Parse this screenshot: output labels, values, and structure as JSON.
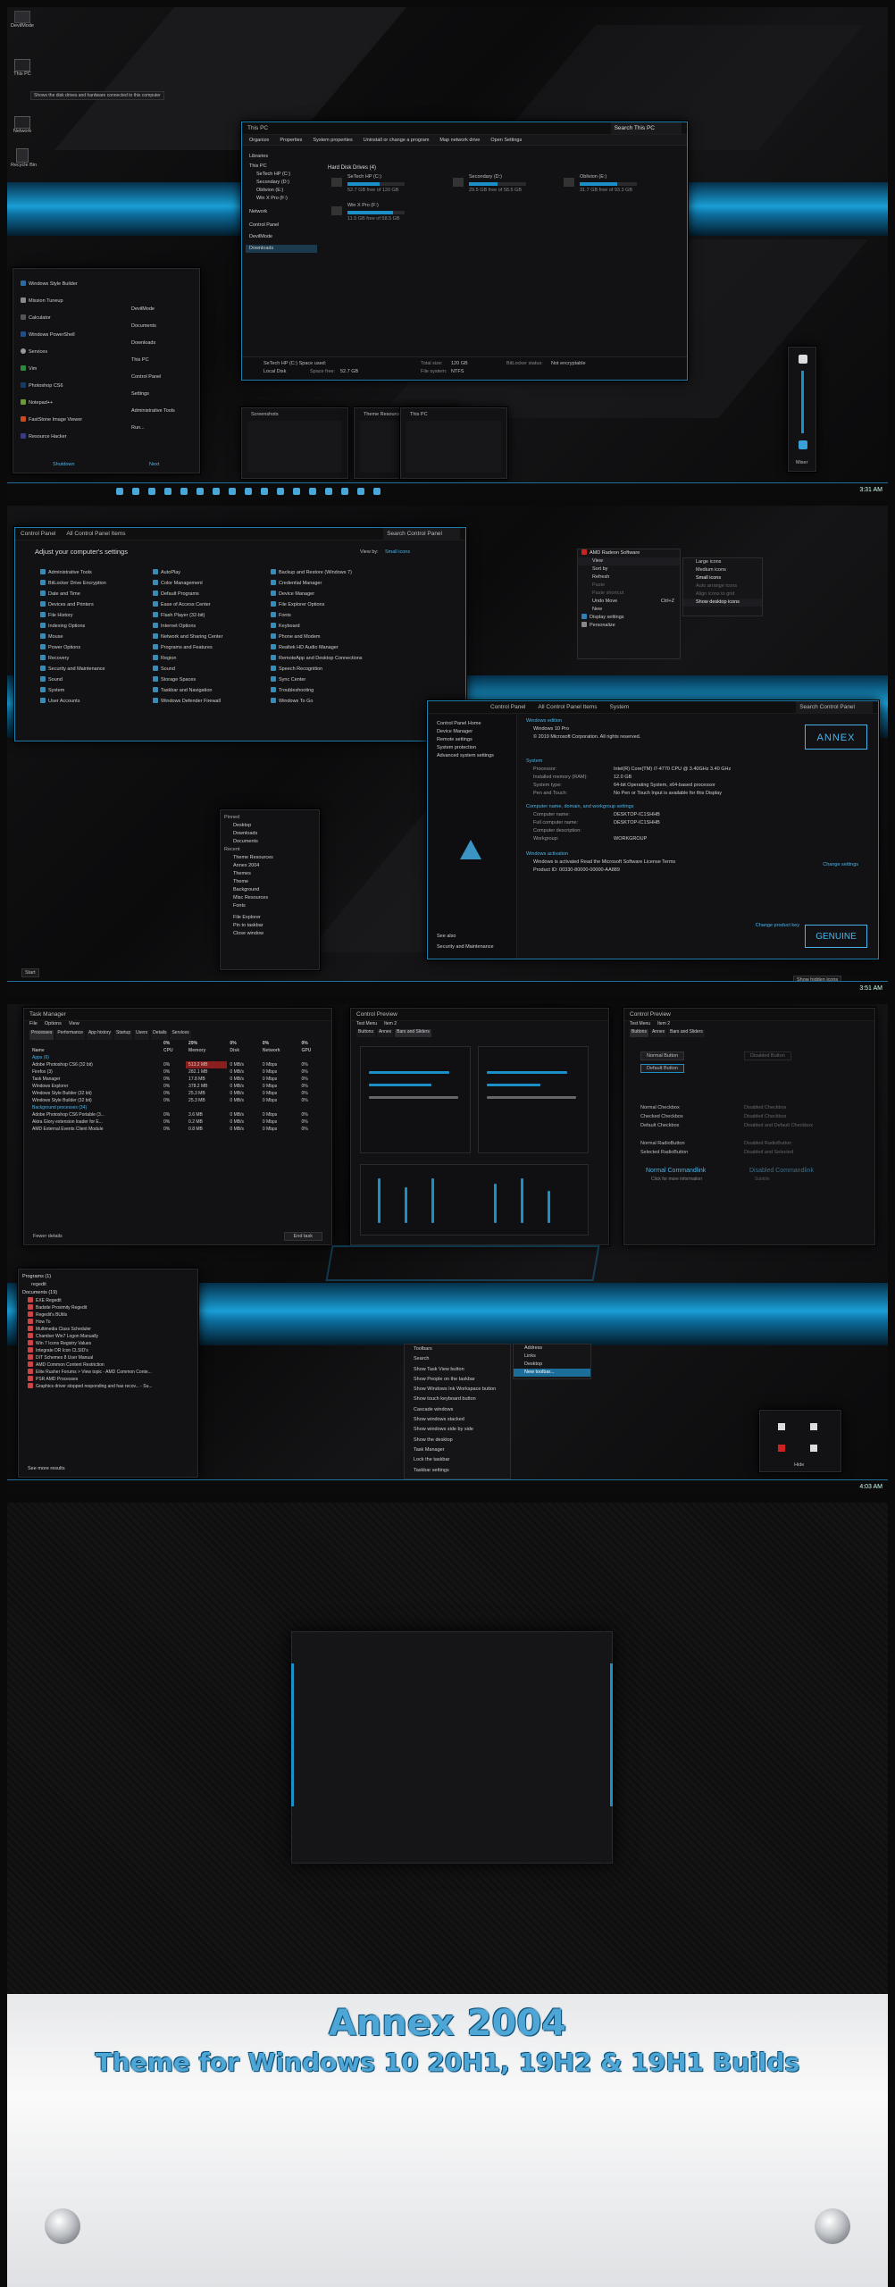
{
  "panel1": {
    "desktop_icons": [
      "DevilMode",
      "This PC",
      "Network",
      "Recycle Bin"
    ],
    "tooltip": "Shows the disk drives and hardware connected to this computer",
    "explorer": {
      "title": "This PC",
      "search_placeholder": "Search This PC",
      "ribbon": [
        "Organize",
        "Properties",
        "System properties",
        "Uninstall or change a program",
        "Map network drive",
        "Open Settings"
      ],
      "nav": [
        "Libraries",
        "This PC",
        "SeTech HP (C:)",
        "Secondary (D:)",
        "Oblivion (E:)",
        "Win X Pro (F:)",
        "Network",
        "Control Panel",
        "DevilMode",
        "Downloads"
      ],
      "group_header": "Hard Disk Drives (4)",
      "drives": [
        {
          "name": "SeTech HP (C:)",
          "free": "52.7 GB free of 120 GB",
          "fill": 0.56
        },
        {
          "name": "Secondary (D:)",
          "free": "29.5 GB free of 58.5 GB",
          "fill": 0.5
        },
        {
          "name": "Oblivion (E:)",
          "free": "31.7 GB free of 93.3 GB",
          "fill": 0.66
        },
        {
          "name": "Win X Pro (F:)",
          "free": "11.5 GB free of 58.5 GB",
          "fill": 0.8
        }
      ],
      "details": {
        "drive": "SeTech HP (C:) Space used:",
        "type": "Local Disk",
        "space_free_label": "Space free:",
        "space_free": "52.7 GB",
        "total_label": "Total size:",
        "total": "120 GB",
        "fs_label": "File system:",
        "fs": "NTFS",
        "bitlocker_label": "BitLocker status:",
        "bitlocker": "Not encryptable"
      }
    },
    "start_menu": {
      "left": [
        "Windows Style Builder",
        "Mission Tuneup",
        "Calculator",
        "Windows PowerShell",
        "Services",
        "Vim",
        "Photoshop CS6",
        "Notepad++",
        "FastStone Image Viewer",
        "Resource Hacker"
      ],
      "right": [
        "DevilMode",
        "Documents",
        "Downloads",
        "This PC",
        "Control Panel",
        "Settings",
        "Administrative Tools",
        "Run..."
      ],
      "footer_left": "Shutdown",
      "footer_right": "Next"
    },
    "thumbnails": [
      "Screenshots",
      "Theme Resources",
      "This PC"
    ],
    "volume_label": "Mixer",
    "clock": "3:31 AM"
  },
  "panel2": {
    "control_panel": {
      "breadcrumb": [
        "Control Panel",
        "All Control Panel Items"
      ],
      "search": "Search Control Panel",
      "header": "Adjust your computer's settings",
      "view_by": "View by:",
      "view_mode": "Small icons",
      "col1": [
        "Administrative Tools",
        "BitLocker Drive Encryption",
        "Date and Time",
        "Devices and Printers",
        "File History",
        "Indexing Options",
        "Mouse",
        "Power Options",
        "Recovery",
        "Security and Maintenance",
        "Sound",
        "System",
        "User Accounts"
      ],
      "col2": [
        "AutoPlay",
        "Color Management",
        "Default Programs",
        "Ease of Access Center",
        "Flash Player (32-bit)",
        "Internet Options",
        "Network and Sharing Center",
        "Programs and Features",
        "Region",
        "Sound",
        "Storage Spaces",
        "Taskbar and Navigation",
        "Windows Defender Firewall"
      ],
      "col3": [
        "Backup and Restore (Windows 7)",
        "Credential Manager",
        "Device Manager",
        "File Explorer Options",
        "Fonts",
        "Keyboard",
        "Phone and Modem",
        "Realtek HD Audio Manager",
        "RemoteApp and Desktop Connections",
        "Speech Recognition",
        "Sync Center",
        "Troubleshooting",
        "Windows To Go"
      ]
    },
    "context_menu": {
      "header": "AMD Radeon Software",
      "items": [
        "View",
        "Sort by",
        "Refresh",
        "Paste",
        "Paste shortcut",
        "Undo Move",
        "New",
        "Display settings",
        "Personalize"
      ],
      "undo_shortcut": "Ctrl+Z",
      "submenu": [
        "Large icons",
        "Medium icons",
        "Small icons",
        "Auto arrange icons",
        "Align icons to grid",
        "Show desktop icons"
      ]
    },
    "system": {
      "breadcrumb": [
        "Control Panel",
        "All Control Panel Items",
        "System"
      ],
      "search": "Search Control Panel",
      "sidebar": [
        "Control Panel Home",
        "Device Manager",
        "Remote settings",
        "System protection",
        "Advanced system settings"
      ],
      "see_also": "See also",
      "security": "Security and Maintenance",
      "edition_header": "Windows edition",
      "edition": "Windows 10 Pro",
      "copyright": "© 2019 Microsoft Corporation. All rights reserved.",
      "system_header": "System",
      "rows": [
        [
          "Processor:",
          "Intel(R) Core(TM) i7-4770 CPU @ 3.40GHz   3.40 GHz"
        ],
        [
          "Installed memory (RAM):",
          "12.0 GB"
        ],
        [
          "System type:",
          "64-bit Operating System, x64-based processor"
        ],
        [
          "Pen and Touch:",
          "No Pen or Touch Input is available for this Display"
        ]
      ],
      "name_header": "Computer name, domain, and workgroup settings",
      "name_rows": [
        [
          "Computer name:",
          "DESKTOP-IC1SHHB"
        ],
        [
          "Full computer name:",
          "DESKTOP-IC1SHHB"
        ],
        [
          "Computer description:",
          ""
        ],
        [
          "Workgroup:",
          "WORKGROUP"
        ]
      ],
      "change_settings": "Change settings",
      "activation_header": "Windows activation",
      "activation": "Windows is activated   Read the Microsoft Software License Terms",
      "product_id": "Product ID: 00330-80000-00000-AA889",
      "change_key": "Change product key",
      "logo1": "ANNEX",
      "logo2": "GENUINE"
    },
    "jump": {
      "pinned": "Pinned",
      "pinned_items": [
        "Desktop",
        "Downloads",
        "Documents"
      ],
      "recent": "Recent",
      "recent_items": [
        "Theme Resources",
        "Annex 2004",
        "Themes",
        "Theme",
        "Background",
        "Misc Resources",
        "Fonts"
      ],
      "actions": [
        "File Explorer",
        "Pin to taskbar",
        "Close window"
      ]
    },
    "start": "Start",
    "show_hidden": "Show hidden icons",
    "clock": "3:51 AM"
  },
  "panel3": {
    "task_manager": {
      "title": "Task Manager",
      "menu": [
        "File",
        "Options",
        "View"
      ],
      "tabs": [
        "Processes",
        "Performance",
        "App history",
        "Startup",
        "Users",
        "Details",
        "Services"
      ],
      "cols": [
        "Name",
        "CPU",
        "Memory",
        "Disk",
        "Network",
        "GPU"
      ],
      "pcts": [
        "0%",
        "29%",
        "0%",
        "0%",
        "0%"
      ],
      "apps_header": "Apps (6)",
      "apps": [
        [
          "Adobe Photoshop CS6 (32 bit)",
          "0%",
          "513.2 MB",
          "0 MB/s",
          "0 Mbps",
          "0%"
        ],
        [
          "Firefox (3)",
          "0%",
          "282.1 MB",
          "0 MB/s",
          "0 Mbps",
          "0%"
        ],
        [
          "Task Manager",
          "0%",
          "17.8 MB",
          "0 MB/s",
          "0 Mbps",
          "0%"
        ],
        [
          "Windows Explorer",
          "0%",
          "378.2 MB",
          "0 MB/s",
          "0 Mbps",
          "0%"
        ],
        [
          "Windows Style Builder (32 bit)",
          "0%",
          "25.3 MB",
          "0 MB/s",
          "0 Mbps",
          "0%"
        ],
        [
          "Windows Style Builder (32 bit)",
          "0%",
          "25.3 MB",
          "0 MB/s",
          "0 Mbps",
          "0%"
        ]
      ],
      "bg_header": "Background processes (34)",
      "bg": [
        [
          "Adobe Photoshop CS6 Portable (3...",
          "0%",
          "3.6 MB",
          "0 MB/s",
          "0 Mbps",
          "0%"
        ],
        [
          "Akira Glory extension loader for E...",
          "0%",
          "0.2 MB",
          "0 MB/s",
          "0 Mbps",
          "0%"
        ],
        [
          "AMD External Events Client Module",
          "0%",
          "0.8 MB",
          "0 MB/s",
          "0 Mbps",
          "0%"
        ]
      ],
      "fewer": "Fewer details",
      "end_task": "End task"
    },
    "preview1": {
      "title": "Control Preview",
      "menu": [
        "Test Menu",
        "Item 2"
      ],
      "tabs": [
        "Buttons",
        "Annex",
        "Bars and Sliders"
      ]
    },
    "preview2": {
      "title": "Control Preview",
      "menu": [
        "Test Menu",
        "Item 2"
      ],
      "tabs": [
        "Buttons",
        "Annex",
        "Bars and Sliders"
      ],
      "buttons": [
        "Normal Button",
        "Default Button",
        "Disabled Button"
      ],
      "checks": [
        "Normal Checkbox",
        "Checked Checkbox",
        "Default Checkbox",
        "Disabled Checkbox",
        "Disabled Checkbox",
        "Disabled and Default Checkbox"
      ],
      "radios": [
        "Normal RadioButton",
        "Selected RadioButton",
        "Disabled RadioButton",
        "Disabled and Selected"
      ],
      "commandlinks": [
        "Normal Commandlink",
        "Disabled Commandlink"
      ],
      "cl_note": "Click for more information",
      "cl_note2": "Subtitle"
    },
    "start_list": {
      "programs": "Programs (1)",
      "program": "regedit",
      "docs": "Documents (19)",
      "docs_items": [
        "EXE Regedit",
        "Badsite Proximity Regedit",
        "Regedit's BUtils",
        "How To",
        "Multimedia Class Scheduler",
        "Chamber Win7 Logon Manually",
        "Win 7 Icons Registry Values",
        "Integrate DR Icon CLSID's",
        "DIT Schemes 8 User Manual",
        "AMD Common Content Restriction",
        "Elite Rusher Forums > View topic - AMD Common Conte...",
        "PSR AMD Processes",
        "Graphics driver stopped responding and has recov... - Su..."
      ],
      "see_more": "See more results"
    },
    "taskbar_menu": {
      "items": [
        "Toolbars",
        "Search",
        "Show Task View button",
        "Show People on the taskbar",
        "Show Windows Ink Workspace button",
        "Show touch keyboard button",
        "Cascade windows",
        "Show windows stacked",
        "Show windows side by side",
        "Show the desktop",
        "Task Manager",
        "Lock the taskbar",
        "Taskbar settings"
      ],
      "sub": [
        "Address",
        "Links",
        "Desktop",
        "New toolbar..."
      ]
    },
    "tray_label": "Hide",
    "clock": "4:03 AM"
  },
  "banner": {
    "title": "Annex 2004",
    "subtitle": "Theme for Windows 10 20H1, 19H2 & 19H1 Builds"
  },
  "colors": {
    "accent": "#1b90c8",
    "accent_light": "#49b4ea",
    "bg": "#0c0c0d",
    "banner_text": "#4da6d6"
  }
}
